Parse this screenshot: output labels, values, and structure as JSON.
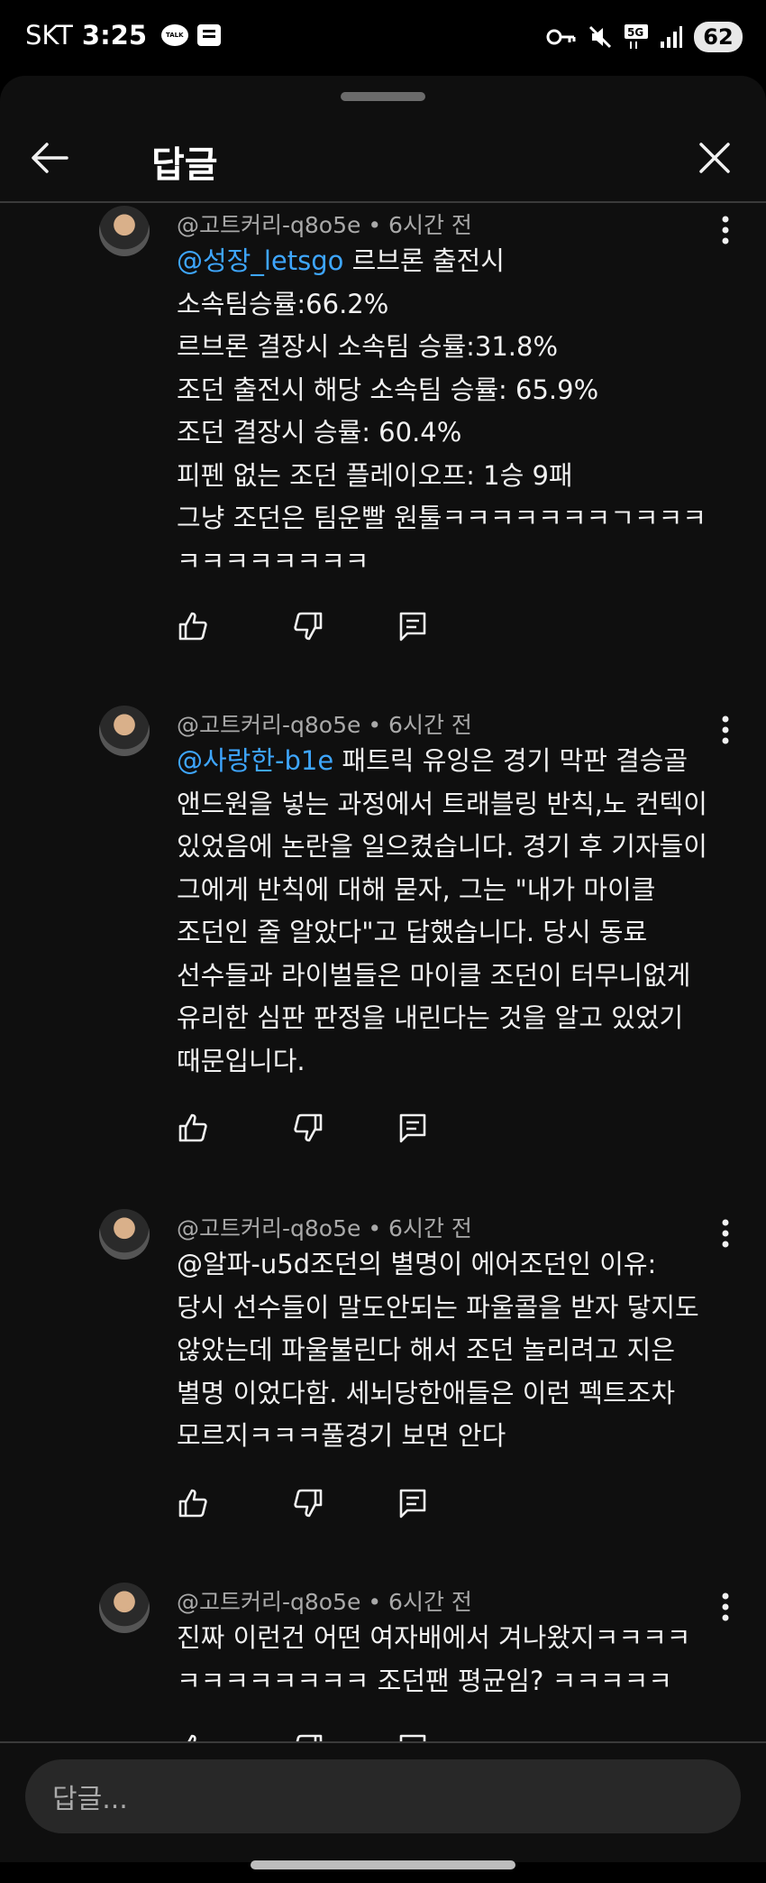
{
  "status_bar": {
    "carrier": "SKT",
    "time": "3:25",
    "battery": "62",
    "icons": [
      "talk-icon",
      "news-icon",
      "key-icon",
      "mute-icon",
      "5g-icon",
      "signal-icon",
      "battery-icon"
    ]
  },
  "header": {
    "title": "답글"
  },
  "comments": [
    {
      "author": "@고트커리-q8o5e",
      "time": "6시간 전",
      "mention": "@성장_letsgo",
      "text": " 르브론 출전시\n소속팀승률:66.2%\n르브론 결장시 소속팀 승률:31.8%\n조던 출전시 해당 소속팀 승률: 65.9%\n조던 결장시 승률: 60.4%\n피펜 없는 조던 플레이오프: 1승 9패\n그냥 조던은 팀운빨 원툴ㅋㅋㅋㅋㅋㅋㅋㄱㅋㅋㅋ\nㅋㅋㅋㅋㅋㅋㅋㅋ"
    },
    {
      "author": "@고트커리-q8o5e",
      "time": "6시간 전",
      "mention": "@사랑한-b1e",
      "text": " 패트릭 유잉은 경기 막판 결승골\n앤드원을 넣는 과정에서 트래블링 반칙,노 컨텍이\n있었음에 논란을 일으켰습니다. 경기 후 기자들이\n그에게 반칙에 대해 묻자, 그는 \"내가 마이클\n조던인 줄 알았다\"고 답했습니다. 당시 동료\n선수들과 라이벌들은 마이클 조던이 터무니없게\n유리한 심판 판정을 내린다는 것을 알고 있었기\n때문입니다."
    },
    {
      "author": "@고트커리-q8o5e",
      "time": "6시간 전",
      "mention": "",
      "text": "@알파-u5d조던의 별명이 에어조던인 이유:\n당시 선수들이 말도안되는 파울콜을 받자 닿지도\n않았는데 파울불린다 해서 조던 놀리려고 지은\n별명 이었다함. 세뇌당한애들은 이런 펙트조차\n모르지ㅋㅋㅋ풀경기 보면 안다"
    },
    {
      "author": "@고트커리-q8o5e",
      "time": "6시간 전",
      "mention": "",
      "text": "진짜 이런건 어떤 여자배에서 겨나왔지ㅋㅋㅋㅋ\nㅋㅋㅋㅋㅋㅋㅋㅋ 조던팬 평균임? ㅋㅋㅋㅋㅋ"
    }
  ],
  "reply": {
    "placeholder": "답글..."
  }
}
